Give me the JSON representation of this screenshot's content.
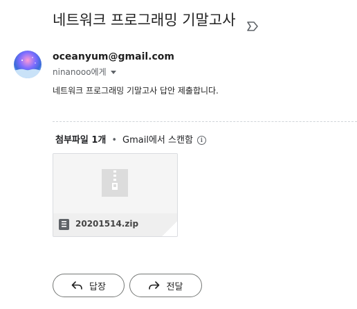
{
  "email": {
    "subject": "네트워크 프로그래밍 기말고사",
    "sender_email": "oceanyum@gmail.com",
    "recipient_text": "ninanooo에게",
    "body": "네트워크 프로그래밍 기말고사 답안 제출합니다."
  },
  "attachments": {
    "count_label": "첨부파일 1개",
    "separator": "•",
    "scan_note": "Gmail에서 스캔함",
    "files": [
      {
        "name": "20201514.zip",
        "icon": "zip-icon"
      }
    ]
  },
  "actions": {
    "reply_label": "답장",
    "forward_label": "전달"
  },
  "colors": {
    "text": "#1f1f1f",
    "secondary": "#5f6368",
    "border": "#747775",
    "card_bg": "#f5f5f5"
  }
}
